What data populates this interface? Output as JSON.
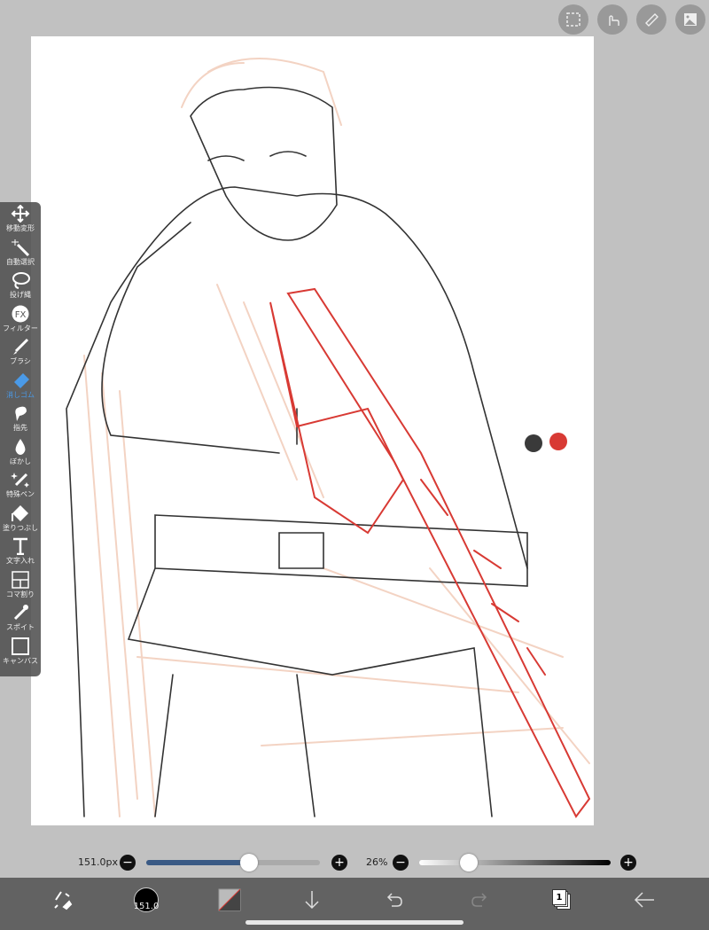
{
  "top_buttons": [
    {
      "icon": "selection-icon"
    },
    {
      "icon": "touch-icon"
    },
    {
      "icon": "ruler-icon"
    },
    {
      "icon": "image-icon"
    }
  ],
  "tools": [
    {
      "label": "移動変形",
      "icon": "move-icon"
    },
    {
      "label": "自動選択",
      "icon": "magic-wand-icon"
    },
    {
      "label": "投げ縄",
      "icon": "lasso-icon"
    },
    {
      "label": "フィルター",
      "icon": "fx-icon"
    },
    {
      "label": "ブラシ",
      "icon": "brush-icon"
    },
    {
      "label": "消しゴム",
      "icon": "eraser-icon",
      "active": true
    },
    {
      "label": "指先",
      "icon": "smudge-icon"
    },
    {
      "label": "ぼかし",
      "icon": "blur-icon"
    },
    {
      "label": "特殊ペン",
      "icon": "special-pen-icon"
    },
    {
      "label": "塗りつぶし",
      "icon": "fill-icon"
    },
    {
      "label": "文字入れ",
      "icon": "text-icon"
    },
    {
      "label": "コマ割り",
      "icon": "frame-divider-icon"
    },
    {
      "label": "スポイト",
      "icon": "eyedropper-icon"
    },
    {
      "label": "キャンバス",
      "icon": "canvas-icon"
    }
  ],
  "color_swatches": [
    "#3a3a3a",
    "#d83a34"
  ],
  "brush_size": {
    "label": "151.0px",
    "fraction": 0.59
  },
  "opacity": {
    "label": "26%",
    "fraction": 0.26
  },
  "bottom": {
    "brush_size_badge": "151.0",
    "layer_count": "1"
  },
  "colors": {
    "accent": "#4a9ae8",
    "slider_fill": "#3a5a85",
    "bar": "#626262",
    "sketch_red": "#d83a34",
    "sketch_peach": "#f0c8b4"
  }
}
